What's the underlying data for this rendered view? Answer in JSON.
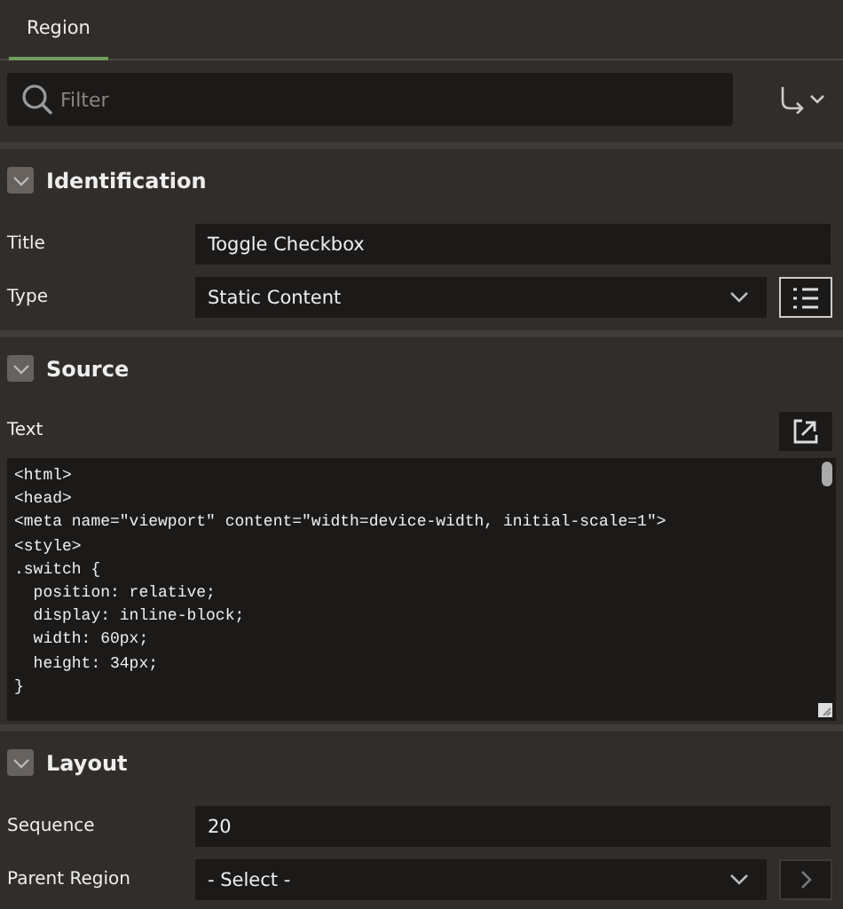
{
  "tabs": [
    {
      "label": "Region",
      "selected": true
    }
  ],
  "filter": {
    "placeholder": "Filter"
  },
  "sections": [
    {
      "title": "Identification",
      "expanded": true,
      "fields": [
        {
          "kind": "text",
          "label": "Title",
          "value": "Toggle Checkbox"
        },
        {
          "kind": "select",
          "label": "Type",
          "value": "Static Content",
          "side_button": {
            "kind": "list"
          }
        }
      ]
    },
    {
      "title": "Source",
      "expanded": true,
      "fields": [
        {
          "kind": "code",
          "label": "Text",
          "lines": [
            "<html>",
            "<head>",
            "<meta name=\"viewport\" content=\"width=device-width, initial-scale=1\">",
            "<style>",
            ".switch {",
            "  position: relative;",
            "  display: inline-block;",
            "  width: 60px;",
            "  height: 34px;",
            "}"
          ]
        }
      ]
    },
    {
      "title": "Layout",
      "expanded": true,
      "fields": [
        {
          "kind": "text",
          "label": "Sequence",
          "value": "20"
        },
        {
          "kind": "select",
          "label": "Parent Region",
          "value": "- Select -",
          "side_button": {
            "kind": "arrow"
          }
        }
      ]
    }
  ]
}
